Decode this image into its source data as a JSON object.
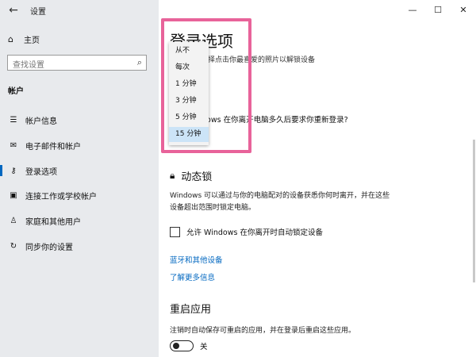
{
  "titlebar": {
    "title": "设置",
    "back_icon": "←",
    "minimize": "—",
    "maximize": "☐",
    "close": "✕"
  },
  "sidebar": {
    "home_label": "主页",
    "search_placeholder": "查找设置",
    "section_title": "帐户",
    "items": [
      {
        "label": "帐户信息",
        "icon": "person-card-icon",
        "active": false
      },
      {
        "label": "电子邮件和帐户",
        "icon": "mail-icon",
        "active": false
      },
      {
        "label": "登录选项",
        "icon": "key-icon",
        "active": true
      },
      {
        "label": "连接工作或学校帐户",
        "icon": "briefcase-icon",
        "active": false
      },
      {
        "label": "家庭和其他用户",
        "icon": "person-add-icon",
        "active": false
      },
      {
        "label": "同步你的设置",
        "icon": "sync-icon",
        "active": false
      }
    ]
  },
  "content": {
    "page_title": "登录选项",
    "sub_desc": "择点击你最喜爱的照片以解锁设备",
    "wake_question": "dows 在你离开电脑多久后要求你重新登录?",
    "dynamic_lock": {
      "title": "动态锁",
      "desc": "Windows 可以通过与你的电脑配对的设备获悉你何时离开，并在这些设备超出范围时锁定电脑。",
      "checkbox_label": "允许 Windows 在你离开时自动锁定设备",
      "checkbox_checked": false
    },
    "links": [
      "蓝牙和其他设备",
      "了解更多信息"
    ],
    "restart": {
      "title": "重启应用",
      "desc": "注销时自动保存可重启的应用，并在登录后重启这些应用。",
      "toggle_label": "关",
      "toggle_on": false
    }
  },
  "dropdown": {
    "options": [
      "从不",
      "每次",
      "1 分钟",
      "3 分钟",
      "5 分钟",
      "15 分钟"
    ],
    "selected_index": 5
  },
  "colors": {
    "accent": "#0067c0",
    "highlight": "#e8639a",
    "sidebar_bg": "#e8eaed",
    "selected_bg": "#cce4f7"
  }
}
